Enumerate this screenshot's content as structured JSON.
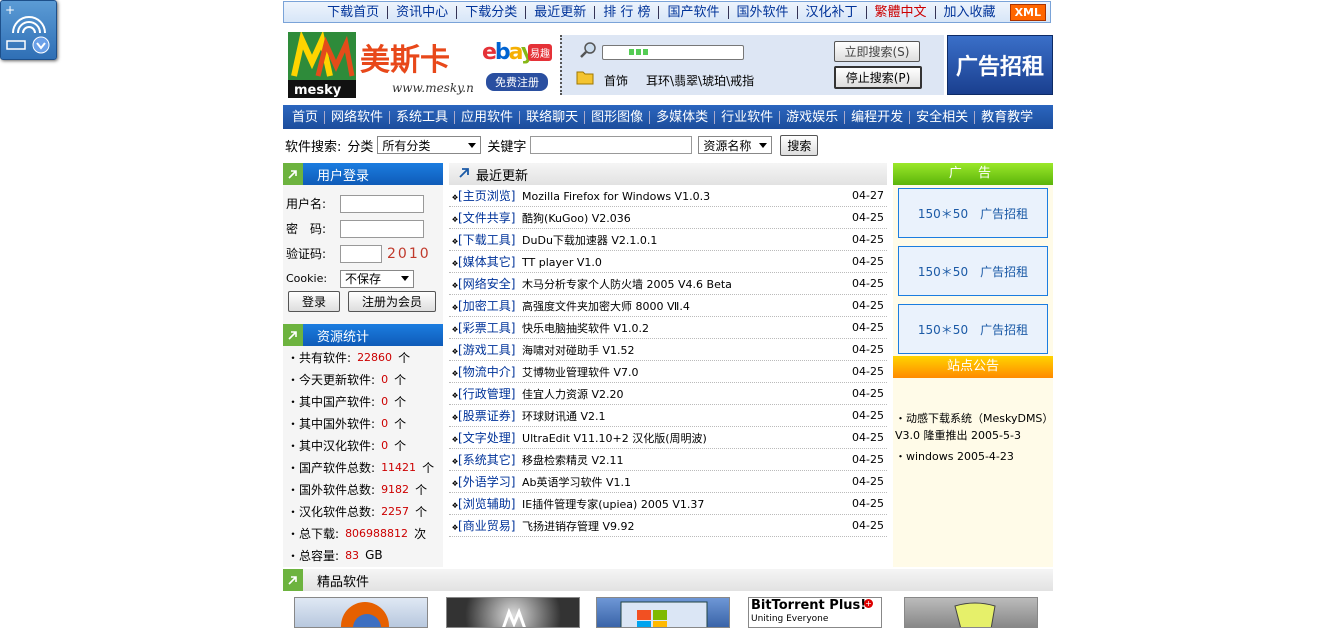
{
  "topnav": {
    "items": [
      "下载首页",
      "资讯中心",
      "下载分类",
      "最近更新",
      "排 行 榜",
      "国产软件",
      "国外软件",
      "汉化补丁",
      "繁體中文",
      "加入收藏"
    ],
    "xml_badge": "XML",
    "accent_red": "#cc0000"
  },
  "header": {
    "logo_text": "美斯卡",
    "logo_sub": "mesky",
    "logo_url": "www.mesky.net",
    "ebay_text": "ebay",
    "ebay_sub": "易趣",
    "ebay_register": "免费注册",
    "quick_links": [
      "首饰",
      "耳环\\翡翠\\琥珀\\戒指"
    ],
    "search_button": "立即搜索(S)",
    "stop_button": "停止搜索(P)",
    "ad_text": "广告招租"
  },
  "catbar": {
    "items": [
      "首页",
      "网络软件",
      "系统工具",
      "应用软件",
      "联络聊天",
      "图形图像",
      "多媒体类",
      "行业软件",
      "游戏娱乐",
      "编程开发",
      "安全相关",
      "教育教学"
    ]
  },
  "search": {
    "label": "软件搜索:",
    "category_label": "分类",
    "category_value": "所有分类",
    "keyword_label": "关键字",
    "type_value": "资源名称",
    "submit": "搜索"
  },
  "login": {
    "title": "用户登录",
    "username_label": "用户名:",
    "password_label": "密　码:",
    "captcha_label": "验证码:",
    "captcha_value": "2010",
    "cookie_label": "Cookie:",
    "cookie_value": "不保存",
    "login_button": "登录",
    "register_button": "注册为会员"
  },
  "stats": {
    "title": "资源统计",
    "rows": [
      {
        "label": "共有软件:",
        "value": "22860",
        "unit": "个"
      },
      {
        "label": "今天更新软件:",
        "value": "0",
        "unit": "个"
      },
      {
        "label": "其中国产软件:",
        "value": "0",
        "unit": "个"
      },
      {
        "label": "其中国外软件:",
        "value": "0",
        "unit": "个"
      },
      {
        "label": "其中汉化软件:",
        "value": "0",
        "unit": "个"
      },
      {
        "label": "国产软件总数:",
        "value": "11421",
        "unit": "个"
      },
      {
        "label": "国外软件总数:",
        "value": "9182",
        "unit": "个"
      },
      {
        "label": "汉化软件总数:",
        "value": "2257",
        "unit": "个"
      },
      {
        "label": "总下载:",
        "value": "806988812",
        "unit": "次"
      },
      {
        "label": "总容量:",
        "value": "83",
        "unit": "GB"
      }
    ]
  },
  "recent": {
    "title": "最近更新",
    "items": [
      {
        "cat": "[主页浏览]",
        "title": "Mozilla Firefox for Windows V1.0.3",
        "date": "04-27"
      },
      {
        "cat": "[文件共享]",
        "title": "酷狗(KuGoo) V2.036",
        "date": "04-25"
      },
      {
        "cat": "[下载工具]",
        "title": "DuDu下载加速器 V2.1.0.1",
        "date": "04-25"
      },
      {
        "cat": "[媒体其它]",
        "title": "TT player V1.0",
        "date": "04-25"
      },
      {
        "cat": "[网络安全]",
        "title": "木马分析专家个人防火墙 2005 V4.6 Beta",
        "date": "04-25"
      },
      {
        "cat": "[加密工具]",
        "title": "高强度文件夹加密大师 8000 Ⅶ.4",
        "date": "04-25"
      },
      {
        "cat": "[彩票工具]",
        "title": "快乐电脑抽奖软件 V1.0.2",
        "date": "04-25"
      },
      {
        "cat": "[游戏工具]",
        "title": "海啸对对碰助手 V1.52",
        "date": "04-25"
      },
      {
        "cat": "[物流中介]",
        "title": "艾博物业管理软件 V7.0",
        "date": "04-25"
      },
      {
        "cat": "[行政管理]",
        "title": "佳宜人力资源 V2.20",
        "date": "04-25"
      },
      {
        "cat": "[股票证券]",
        "title": "环球财讯通 V2.1",
        "date": "04-25"
      },
      {
        "cat": "[文字处理]",
        "title": "UltraEdit V11.10+2 汉化版(周明波)",
        "date": "04-25"
      },
      {
        "cat": "[系统其它]",
        "title": "移盘检索精灵 V2.11",
        "date": "04-25"
      },
      {
        "cat": "[外语学习]",
        "title": "Ab英语学习软件 V1.1",
        "date": "04-25"
      },
      {
        "cat": "[浏览辅助]",
        "title": "IE插件管理专家(upiea) 2005 V1.37",
        "date": "04-25"
      },
      {
        "cat": "[商业贸易]",
        "title": "飞扬进销存管理 V9.92",
        "date": "04-25"
      }
    ]
  },
  "ads": {
    "title": "广 告",
    "slots": [
      "150＊50　广告招租",
      "150＊50　广告招租",
      "150＊50　广告招租"
    ]
  },
  "notice": {
    "title": "站点公告",
    "items": [
      "・动感下载系统（MeskyDMS）V3.0 隆重推出 2005-5-3",
      "・windows 2005-4-23"
    ]
  },
  "featured": {
    "title": "精品软件",
    "thumbs": [
      "firefox-thumb",
      "motorola-thumb",
      "windows-thumb",
      "bittorrent-thumb",
      "program-thumb"
    ],
    "bittorrent_title": "BitTorrent Plus!",
    "bittorrent_sub": "Uniting Everyone"
  }
}
